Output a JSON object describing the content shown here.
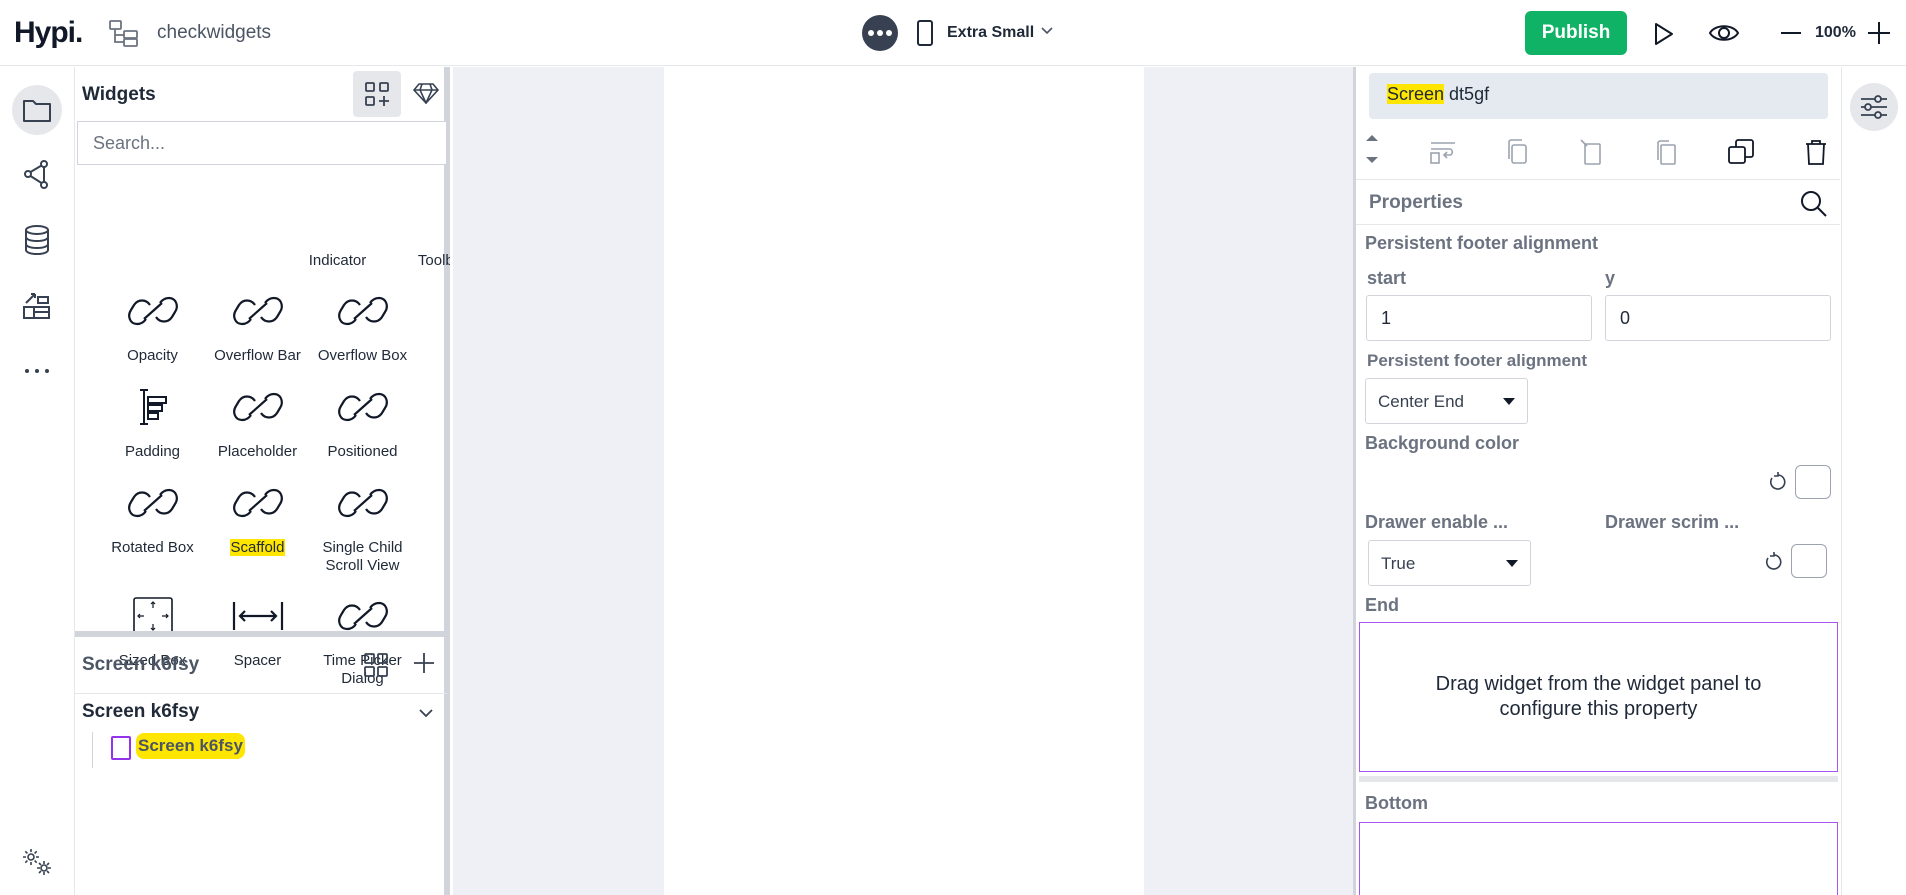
{
  "header": {
    "logo": "Hypi.",
    "project_name": "checkwidgets",
    "device_label": "Extra Small",
    "publish_label": "Publish",
    "zoom_label": "100%"
  },
  "widgets_panel": {
    "title": "Widgets",
    "search_placeholder": "Search...",
    "top_partial_labels": [
      "Indicator",
      "Toolbar"
    ],
    "items": [
      {
        "name": "Opacity",
        "icon": "link-icon"
      },
      {
        "name": "Overflow Bar",
        "icon": "link-icon"
      },
      {
        "name": "Overflow Box",
        "icon": "link-icon"
      },
      {
        "name": "Padding",
        "icon": "padding-icon"
      },
      {
        "name": "Placeholder",
        "icon": "link-icon"
      },
      {
        "name": "Positioned",
        "icon": "link-icon"
      },
      {
        "name": "Rotated Box",
        "icon": "link-icon"
      },
      {
        "name": "Scaffold",
        "icon": "link-icon"
      },
      {
        "name": "Single Child Scroll View",
        "icon": "link-icon"
      },
      {
        "name": "Sized Box",
        "icon": "sized-box-icon"
      },
      {
        "name": "Spacer",
        "icon": "spacer-icon"
      },
      {
        "name": "Time Picker Dialog",
        "icon": "link-icon"
      }
    ]
  },
  "tree": {
    "header": "Screen k6fsy",
    "root": "Screen k6fsy",
    "child": "Screen k6fsy"
  },
  "properties": {
    "selected_prefix": "Screen",
    "selected_suffix": " dt5gf",
    "title": "Properties",
    "pf_alignment_label": "Persistent footer alignment",
    "start_label": "start",
    "start_value": "1",
    "y_label": "y",
    "y_value": "0",
    "pf_alignment_label2": "Persistent footer alignment",
    "pf_alignment_value": "Center End",
    "bg_color_label": "Background color",
    "drawer_enable_label": "Drawer enable ...",
    "drawer_enable_value": "True",
    "drawer_scrim_label": "Drawer scrim ...",
    "end_label": "End",
    "dropzone_text": "Drag widget from the widget panel to configure this property",
    "bottom_label": "Bottom"
  },
  "colors": {
    "publish": "#10b365",
    "highlight": "#ffe600",
    "dropzone_border": "#a855f7"
  }
}
